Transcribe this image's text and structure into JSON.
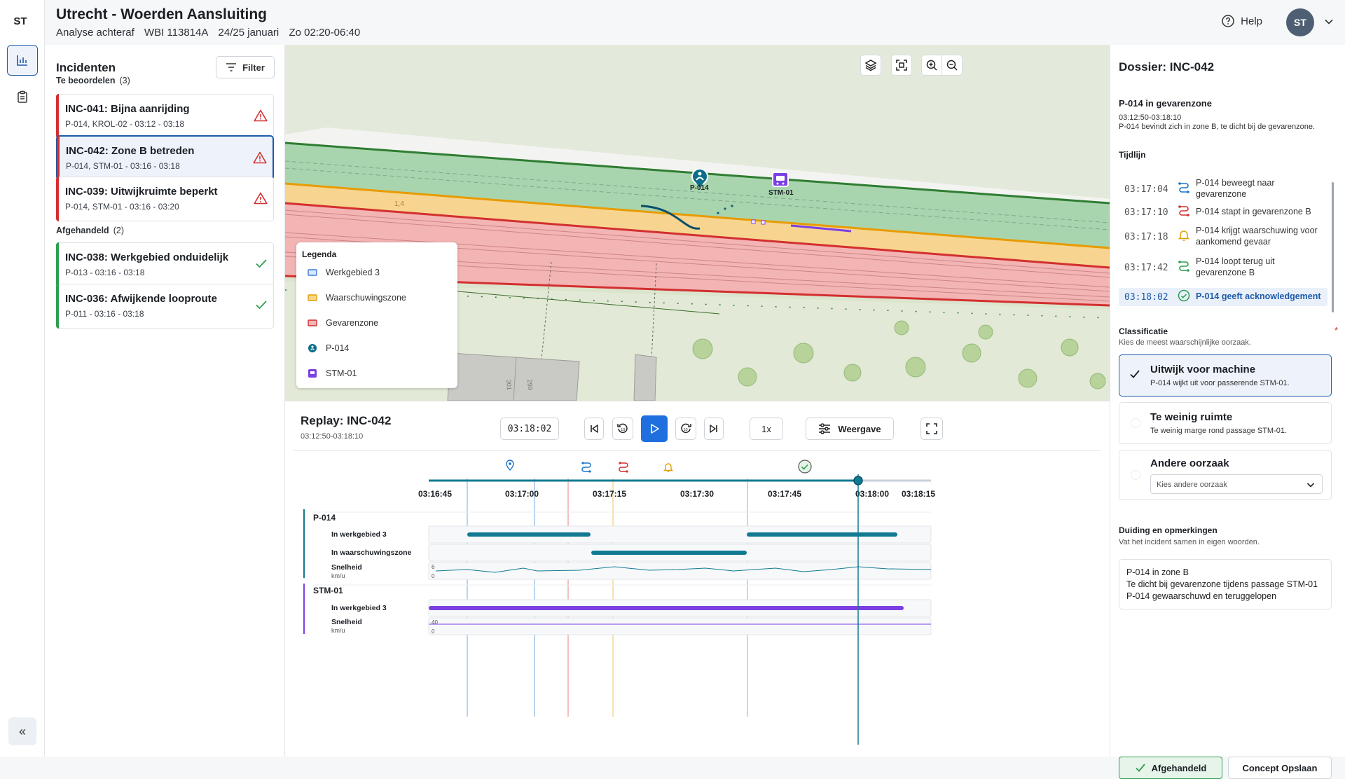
{
  "rail": {
    "logo": "ST",
    "collapse_label": "«"
  },
  "header": {
    "title": "Utrecht - Woerden Aansluiting",
    "subtitle": [
      "Analyse achteraf",
      "WBI 113814A",
      "24/25 januari",
      "Zo 02:20-06:40"
    ],
    "help_label": "Help",
    "avatar_initials": "ST"
  },
  "incidents": {
    "title": "Incidenten",
    "filter_label": "Filter",
    "sections": [
      {
        "label": "Te beoordelen",
        "count": "(3)",
        "items": [
          {
            "title": "INC-041: Bijna aanrijding",
            "sub": "P-014, KROL-02 - 03:12 - 03:18",
            "status": "warning"
          },
          {
            "title": "INC-042: Zone B betreden",
            "sub": "P-014, STM-01 - 03:16 - 03:18",
            "status": "warning",
            "selected": true
          },
          {
            "title": "INC-039: Uitwijkruimte beperkt",
            "sub": "P-014, STM-01 - 03:16 - 03:20",
            "status": "warning"
          }
        ]
      },
      {
        "label": "Afgehandeld",
        "count": "(2)",
        "items": [
          {
            "title": "INC-038: Werkgebied onduidelijk",
            "sub": "P-013 - 03:16 - 03:18",
            "status": "done"
          },
          {
            "title": "INC-036: Afwijkende looproute",
            "sub": "P-011 - 03:16 - 03:18",
            "status": "done"
          }
        ]
      }
    ]
  },
  "map": {
    "legend_title": "Legenda",
    "legend": [
      {
        "label": "Werkgebied 3",
        "color": "#3a7bd5"
      },
      {
        "label": "Waarschuwingszone",
        "color": "#e0a100"
      },
      {
        "label": "Gevarenzone",
        "color": "#d32f2f"
      },
      {
        "label": "P-014",
        "color": "#0b6e8a"
      },
      {
        "label": "STM-01",
        "color": "#7b3fe4"
      }
    ],
    "labels": {
      "person": "P-014",
      "machine": "STM-01",
      "km": "1,4",
      "building_a": "301",
      "building_b": "299"
    }
  },
  "replay": {
    "title": "Replay: INC-042",
    "range": "03:12:50-03:18:10",
    "time": "03:18:02",
    "speed": "1x",
    "view_label": "Weergave",
    "ticks": [
      "03:16:45",
      "03:17:00",
      "03:17:15",
      "03:17:30",
      "03:17:45",
      "03:18:00",
      "03:18:15"
    ],
    "entities": [
      {
        "name": "P-014",
        "color": "#117a92",
        "rows": [
          {
            "label": "In werkgebied 3"
          },
          {
            "label": "In waarschuwingszone"
          },
          {
            "label": "Snelheid",
            "unit": "km/u",
            "max": "6",
            "min": "0"
          }
        ]
      },
      {
        "name": "STM-01",
        "color": "#7b3fe4",
        "rows": [
          {
            "label": "In werkgebied 3"
          },
          {
            "label": "Snelheid",
            "unit": "km/u",
            "max": "40",
            "min": "0"
          }
        ]
      }
    ]
  },
  "dossier": {
    "title": "Dossier: INC-042",
    "subject": "P-014 in gevarenzone",
    "range": "03:12:50-03:18:10",
    "desc": "P-014 bevindt zich in zone B, te dicht bij de gevarenzone.",
    "timeline_label": "Tijdlijn",
    "timeline": [
      {
        "time": "03:17:04",
        "text": "P-014 beweegt naar gevarenzone",
        "icon": "route-icon",
        "color": "#1a73c9"
      },
      {
        "time": "03:17:10",
        "text": "P-014 stapt in gevarenzone B",
        "icon": "route-icon",
        "color": "#d32f2f"
      },
      {
        "time": "03:17:18",
        "text": "P-014 krijgt waarschuwing voor aankomend gevaar",
        "icon": "bell-icon",
        "color": "#e0a100"
      },
      {
        "time": "03:17:42",
        "text": "P-014 loopt terug uit gevarenzone B",
        "icon": "route-icon",
        "color": "#2e9e4f"
      },
      {
        "time": "03:18:02",
        "text": "P-014 geeft acknowledgement",
        "icon": "check-circle-icon",
        "color": "#2e9e4f",
        "active": true
      }
    ],
    "class_label": "Classificatie",
    "required_mark": "*",
    "class_hint": "Kies de meest waarschijnlijke oorzaak.",
    "options": [
      {
        "title": "Uitwijk voor machine",
        "sub": "P-014 wijkt uit voor passerende STM-01.",
        "selected": true
      },
      {
        "title": "Te weinig ruimte",
        "sub": "Te weinig marge rond passage STM-01."
      },
      {
        "title": "Andere oorzaak",
        "placeholder": "Kies andere oorzaak"
      }
    ],
    "notes_label": "Duiding en opmerkingen",
    "notes_hint": "Vat het incident samen in eigen woorden.",
    "notes": [
      "P-014 in zone B",
      "Te dicht bij gevarenzone tijdens passage STM-01",
      "P-014 gewaarschuwd en teruggelopen"
    ],
    "done_label": "Afgehandeld",
    "save_label": "Concept Opslaan"
  }
}
